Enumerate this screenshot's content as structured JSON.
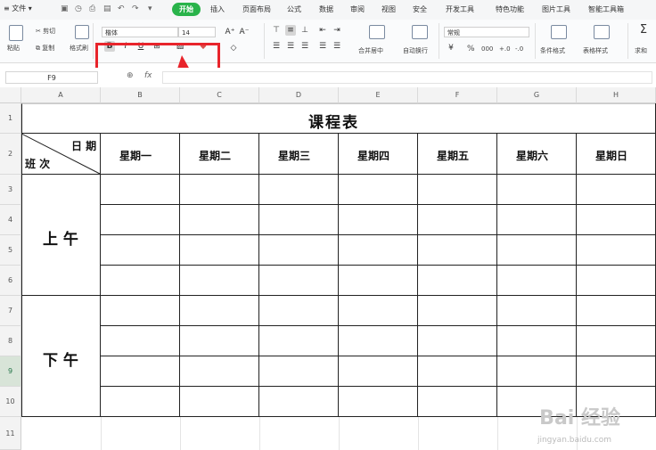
{
  "menubar": {
    "file_label": "≡ 文件 ▾",
    "tabs": [
      "开始",
      "插入",
      "页面布局",
      "公式",
      "数据",
      "审阅",
      "视图",
      "安全",
      "开发工具",
      "特色功能",
      "图片工具",
      "智能工具箱"
    ],
    "active_tab": "开始"
  },
  "ribbon": {
    "paste_label": "粘贴",
    "cut_label": "剪切",
    "copy_label": "复制",
    "format_painter_label": "格式刷",
    "font_name": "楷体",
    "font_size": "14",
    "bold": "B",
    "italic": "I",
    "underline": "U",
    "increase_font": "A⁺",
    "decrease_font": "A⁻",
    "merge_label": "合并居中",
    "wrap_label": "自动换行",
    "number_format": "常规",
    "percent": "%",
    "thousand_sep": "000",
    "decimal_inc": "+.0",
    "decimal_dec": "-.0",
    "cond_format_label": "条件格式",
    "table_style_label": "表格样式",
    "sum_label": "求和"
  },
  "formulabar": {
    "cell_ref": "F9",
    "fx_label": "fx",
    "formula": ""
  },
  "sheet": {
    "columns": [
      "A",
      "B",
      "C",
      "D",
      "E",
      "F",
      "G",
      "H"
    ],
    "rows": [
      "1",
      "2",
      "3",
      "4",
      "5",
      "6",
      "7",
      "8",
      "9",
      "10",
      "11"
    ],
    "selected_row": "9",
    "title": "课程表",
    "corner_top": "日 期",
    "corner_bottom": "班 次",
    "days": [
      "星期一",
      "星期二",
      "星期三",
      "星期四",
      "星期五",
      "星期六",
      "星期日"
    ],
    "morning": "上 午",
    "afternoon": "下 午"
  },
  "watermark": {
    "text": "Bai 经验",
    "sub": "jingyan.baidu.com"
  }
}
